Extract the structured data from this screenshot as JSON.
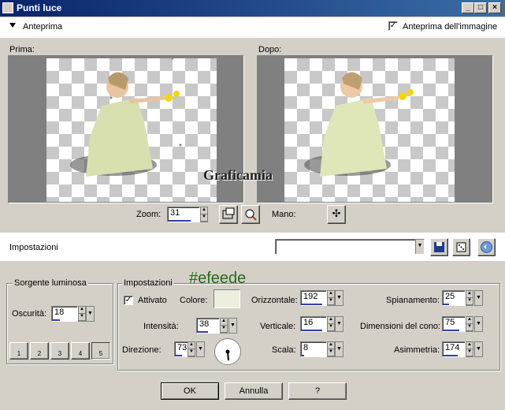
{
  "window": {
    "title": "Punti luce",
    "min_label": "_",
    "max_label": "□",
    "close_label": "×"
  },
  "preview": {
    "toggle_label": "Anteprima",
    "image_preview_label": "Anteprima dell'immagine",
    "image_preview_checked": true
  },
  "before_label": "Prima:",
  "after_label": "Dopo:",
  "watermark": "Graficamia",
  "zoom": {
    "label": "Zoom:",
    "value": "31"
  },
  "pan": {
    "label": "Mano:"
  },
  "presets": {
    "label": "Impostazioni",
    "value": ""
  },
  "annotation": "#efeede",
  "light_source": {
    "group_label": "Sorgente luminosa",
    "darkness_label": "Oscurità:",
    "darkness_value": "18",
    "preset_numbers": [
      "1",
      "2",
      "3",
      "4",
      "5"
    ]
  },
  "settings": {
    "group_label": "Impostazioni",
    "enabled_label": "Attivato",
    "enabled_checked": true,
    "color_label": "Colore:",
    "color_value": "#efeede",
    "intensity_label": "Intensità:",
    "intensity_value": "38",
    "direction_label": "Direzione:",
    "direction_value": "73",
    "horizontal_label": "Orizzontale:",
    "horizontal_value": "192",
    "vertical_label": "Verticale:",
    "vertical_value": "16",
    "scale_label": "Scala:",
    "scale_value": "8",
    "smoothing_label": "Spianamento:",
    "smoothing_value": "25",
    "cone_label": "Dimensioni del cono:",
    "cone_value": "75",
    "asymmetry_label": "Asimmetria:",
    "asymmetry_value": "174"
  },
  "buttons": {
    "ok": "OK",
    "cancel": "Annulla",
    "help": "?"
  }
}
